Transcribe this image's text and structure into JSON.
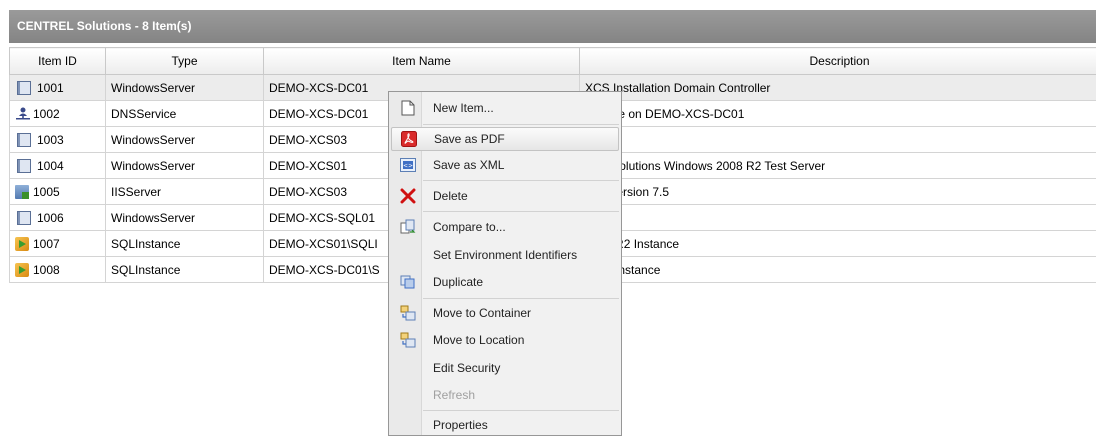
{
  "panel": {
    "title": "CENTREL Solutions - 8 Item(s)"
  },
  "columns": [
    "Item ID",
    "Type",
    "Item Name",
    "Description"
  ],
  "rows": [
    {
      "id": "1001",
      "type": "WindowsServer",
      "name": "DEMO-XCS-DC01",
      "desc": "XCS Installation Domain Controller",
      "icon": "windows-server-icon"
    },
    {
      "id": "1002",
      "type": "DNSService",
      "name": "DEMO-XCS-DC01",
      "desc": "Service on DEMO-XCS-DC01",
      "icon": "dns-service-icon"
    },
    {
      "id": "1003",
      "type": "WindowsServer",
      "name": "DEMO-XCS03",
      "desc": "",
      "icon": "windows-server-icon"
    },
    {
      "id": "1004",
      "type": "WindowsServer",
      "name": "DEMO-XCS01",
      "desc": "REL Solutions Windows 2008 R2 Test Server",
      "icon": "windows-server-icon"
    },
    {
      "id": "1005",
      "type": "IISServer",
      "name": "DEMO-XCS03",
      "desc": "rver Version 7.5",
      "icon": "iis-server-icon"
    },
    {
      "id": "1006",
      "type": "WindowsServer",
      "name": "DEMO-XCS-SQL01",
      "desc": "",
      "icon": "windows-server-icon"
    },
    {
      "id": "1007",
      "type": "SQLInstance",
      "name": "DEMO-XCS01\\SQLI",
      "desc": "2008 R2 Instance",
      "icon": "sql-instance-icon"
    },
    {
      "id": "1008",
      "type": "SQLInstance",
      "name": "DEMO-XCS-DC01\\S",
      "desc": "2005 Instance",
      "icon": "sql-instance-icon"
    }
  ],
  "menu": {
    "new_item": "New Item...",
    "save_pdf": "Save as PDF",
    "save_xml": "Save as XML",
    "delete": "Delete",
    "compare": "Compare to...",
    "set_env": "Set Environment Identifiers",
    "duplicate": "Duplicate",
    "move_container": "Move to Container",
    "move_location": "Move to Location",
    "edit_security": "Edit Security",
    "refresh": "Refresh",
    "properties": "Properties"
  },
  "colors": {
    "header_bg": "#8e8e8e",
    "pdf_red": "#d92b2b",
    "delete_red": "#d01010"
  }
}
